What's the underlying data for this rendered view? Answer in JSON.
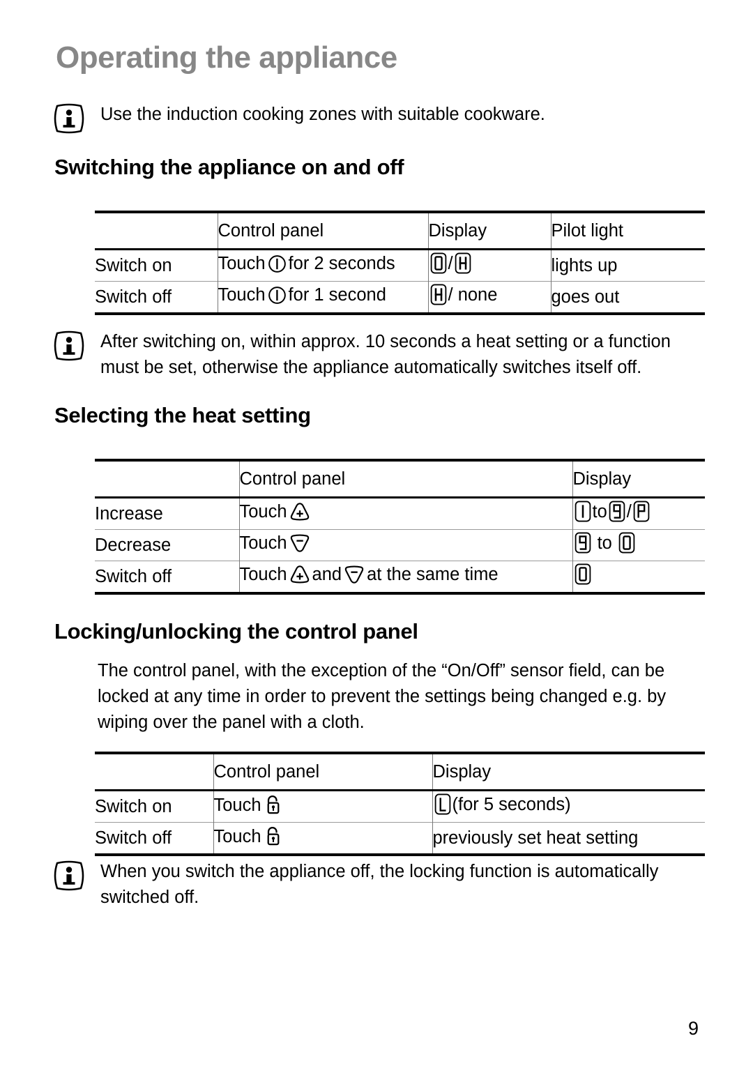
{
  "document": {
    "page_title": "Operating the appliance",
    "page_number": "9"
  },
  "intro_note": {
    "icon": "info-icon",
    "text": "Use the induction cooking zones with suitable cookware."
  },
  "sections": [
    {
      "heading": "Switching the appliance on and off",
      "table": {
        "columns": [
          "",
          "Control panel",
          "Display",
          "Pilot light"
        ],
        "rows": [
          {
            "action": "Switch on",
            "control_prefix": "Touch",
            "control_symbol": "power-onoff-icon",
            "control_suffix": "for 2 seconds",
            "display_segments": [
              "0",
              "/",
              "H"
            ],
            "pilot_light": "lights up"
          },
          {
            "action": "Switch off",
            "control_prefix": "Touch",
            "control_symbol": "power-onoff-icon",
            "control_suffix": "for 1 second",
            "display_segments": [
              "H",
              "/",
              "none"
            ],
            "pilot_light": "goes out"
          }
        ]
      }
    },
    {
      "heading": "Selecting the heat setting",
      "table": {
        "columns": [
          "",
          "Control panel",
          "Display"
        ],
        "rows": [
          {
            "action": "Increase",
            "control_prefix": "Touch",
            "control_symbol": "plus-triangle-icon",
            "control_suffix": "",
            "display_segments": [
              "1",
              "to",
              "9",
              "/",
              "P"
            ]
          },
          {
            "action": "Decrease",
            "control_prefix": "Touch",
            "control_symbol": "minus-triangle-icon",
            "control_suffix": "",
            "display_segments": [
              "9",
              "to",
              "0"
            ]
          },
          {
            "action": "Switch off",
            "control_prefix": "Touch",
            "control_symbol": "plus-triangle-icon",
            "control_mid": "and",
            "control_symbol2": "minus-triangle-icon",
            "control_suffix": "at the same time",
            "display_segments": [
              "0"
            ]
          }
        ]
      }
    },
    {
      "heading": "Locking/unlocking the control panel",
      "body_text": "The control panel, with the exception of the “On/Off” sensor field, can be locked at any time in order to prevent the settings being changed e.g. by wiping over the panel with a cloth.",
      "table": {
        "columns": [
          "",
          "Control panel",
          "Display"
        ],
        "rows": [
          {
            "action": "Switch on",
            "control_prefix": "Touch",
            "control_symbol": "padlock-icon",
            "display_segment": "L",
            "display_text": "(for 5 seconds)"
          },
          {
            "action": "Switch off",
            "control_prefix": "Touch",
            "control_symbol": "padlock-icon",
            "display_segment": "",
            "display_text": "previously set heat setting"
          }
        ]
      }
    }
  ],
  "notes": [
    {
      "icon": "info-icon",
      "line1": "After switching on, within approx. 10 seconds a heat setting or a function",
      "line2": "must be set, otherwise the appliance automatically switches itself off."
    },
    {
      "icon": "info-icon",
      "line1": "When you switch the appliance off, the locking function is automatically",
      "line2": "switched off."
    }
  ],
  "colors": {
    "title_gray": "#878787",
    "text_black": "#000000",
    "rule_gray": "#9a9a9a"
  }
}
